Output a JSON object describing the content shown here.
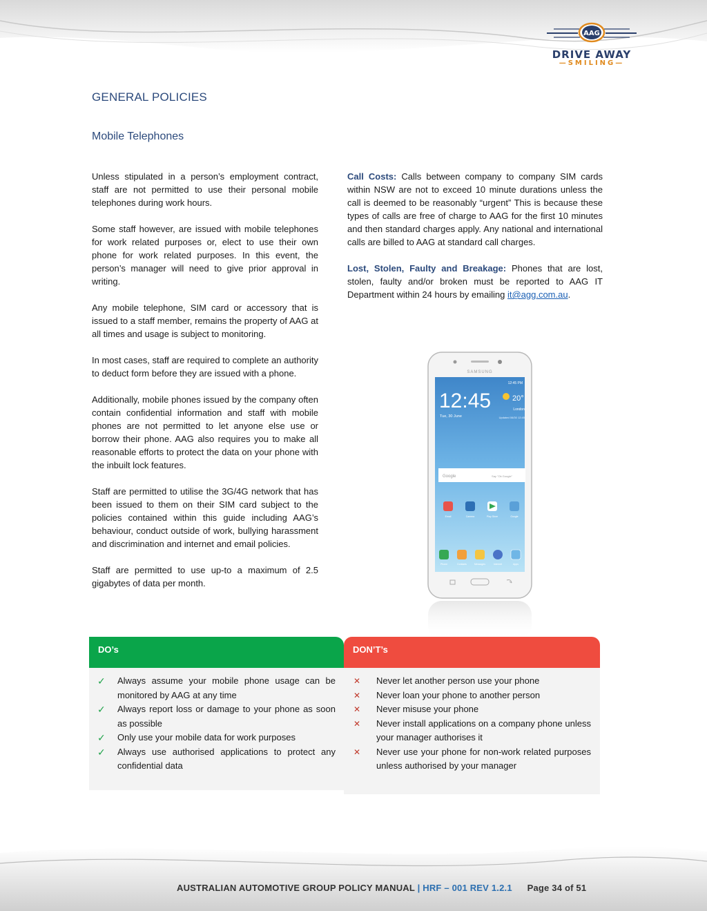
{
  "logo": {
    "badge": "AAG",
    "main": "DRIVE AWAY",
    "sub": "SMILING"
  },
  "heading": "GENERAL POLICIES",
  "subheading": "Mobile Telephones",
  "left_paragraphs": [
    "Unless stipulated in a person’s employment contract, staff are not permitted to use their personal mobile telephones during work hours.",
    "Some staff however, are issued with mobile telephones for work related purposes or, elect to use their own phone for work related purposes. In this event, the person’s manager will need to give prior approval in writing.",
    "Any mobile telephone, SIM card or accessory that is issued to a staff member, remains the property of AAG at all times and usage is subject to monitoring.",
    "In most cases, staff are required to complete an authority to deduct form before they are issued with a phone.",
    "Additionally, mobile phones issued by the company often contain confidential information and staff with mobile phones are not permitted to let anyone else use or borrow their phone. AAG also requires you to make all reasonable efforts to protect the data on your phone with the inbuilt lock features.",
    "Staff are permitted to utilise the 3G/4G network that has been issued to them on their SIM card subject to the policies contained within this guide including AAG’s behaviour, conduct outside of work, bullying harassment and discrimination and internet and email policies.",
    "Staff are permitted to use up-to a maximum of 2.5 gigabytes of data per month."
  ],
  "call_costs": {
    "lead": "Call Costs:",
    "text": " Calls between company to company SIM cards within NSW are not to exceed 10 minute durations unless the call is deemed to be reasonably “urgent” This is because these types of calls are free of charge to AAG for the first 10 minutes and then standard charges apply. Any national and international calls are billed to AAG at standard call charges."
  },
  "lost_stolen": {
    "lead": "Lost, Stolen, Faulty and Breakage:",
    "text": " Phones that are lost, stolen, faulty and/or broken must be reported to AAG IT Department within 24 hours by emailing ",
    "email": "it@agg.com.au",
    "end": "."
  },
  "phone": {
    "brand": "SAMSUNG",
    "status_time": "12:45 PM",
    "clock": "12:45",
    "date": "Tue, 30 June",
    "temp": "20°",
    "city": "London",
    "updated": "Updated 06/30 12:45",
    "search_brand": "Google",
    "search_hint": "Say \"Ok Google\"",
    "apps_row1": [
      "Email",
      "Camera",
      "Play Store",
      "Google"
    ],
    "apps_row2": [
      "Phone",
      "Contacts",
      "Messages",
      "Internet",
      "Apps"
    ]
  },
  "dos": {
    "title": "DO’s",
    "items": [
      "Always assume your mobile phone usage can be monitored by AAG at any time",
      "Always report loss or damage to your phone as soon as possible",
      "Only use your mobile data for work purposes",
      "Always use authorised applications to protect any confidential data"
    ]
  },
  "donts": {
    "title": "DON’T’s",
    "items": [
      "Never let another person use your phone",
      "Never loan your phone to another person",
      "Never misuse your phone",
      "Never install applications on a company phone unless your manager authorises it",
      "Never use your phone for non-work related purposes unless authorised by your manager"
    ]
  },
  "footer": {
    "manual": "AUSTRALIAN AUTOMOTIVE GROUP POLICY MANUAL",
    "sep": "|",
    "code": "HRF – 001 REV 1.2.1",
    "page": "Page 34 of 51"
  },
  "colors": {
    "heading": "#2c4a7c",
    "do_header": "#0aa54a",
    "dont_header": "#ef4c3f",
    "accent_orange": "#e08a1e"
  }
}
